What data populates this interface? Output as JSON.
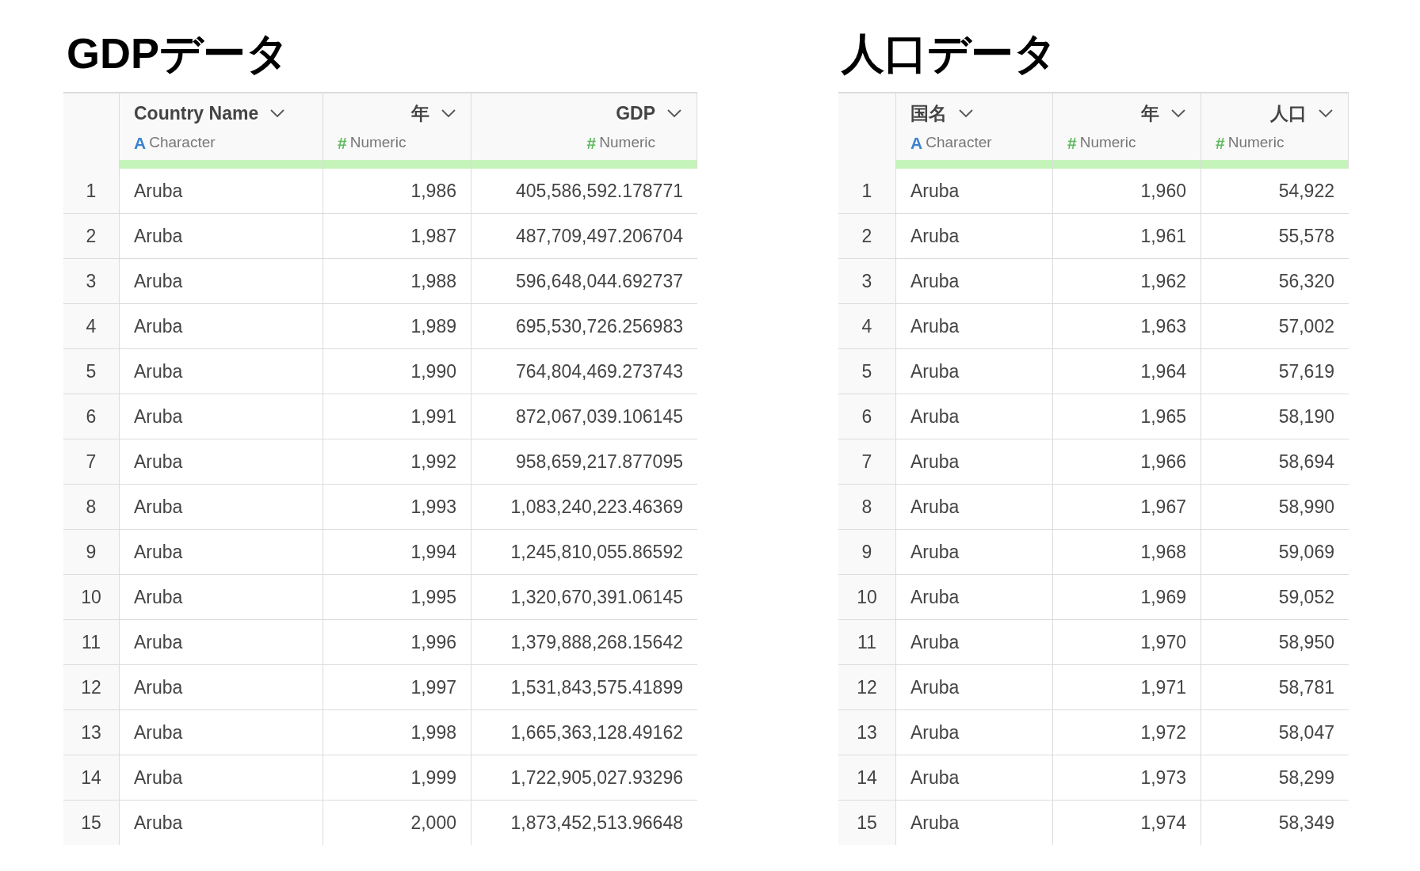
{
  "tables": [
    {
      "title": "GDPデータ",
      "columns": [
        {
          "name": "Country Name",
          "kind": "character",
          "type_symbol": "A",
          "type_label": "Character"
        },
        {
          "name": "年",
          "kind": "numeric",
          "type_symbol": "#",
          "type_label": "Numeric"
        },
        {
          "name": "GDP",
          "kind": "numeric",
          "type_symbol": "#",
          "type_label": "Numeric"
        }
      ],
      "rows": [
        {
          "index": "1",
          "cells": [
            "Aruba",
            "1,986",
            "405,586,592.178771"
          ]
        },
        {
          "index": "2",
          "cells": [
            "Aruba",
            "1,987",
            "487,709,497.206704"
          ]
        },
        {
          "index": "3",
          "cells": [
            "Aruba",
            "1,988",
            "596,648,044.692737"
          ]
        },
        {
          "index": "4",
          "cells": [
            "Aruba",
            "1,989",
            "695,530,726.256983"
          ]
        },
        {
          "index": "5",
          "cells": [
            "Aruba",
            "1,990",
            "764,804,469.273743"
          ]
        },
        {
          "index": "6",
          "cells": [
            "Aruba",
            "1,991",
            "872,067,039.106145"
          ]
        },
        {
          "index": "7",
          "cells": [
            "Aruba",
            "1,992",
            "958,659,217.877095"
          ]
        },
        {
          "index": "8",
          "cells": [
            "Aruba",
            "1,993",
            "1,083,240,223.46369"
          ]
        },
        {
          "index": "9",
          "cells": [
            "Aruba",
            "1,994",
            "1,245,810,055.86592"
          ]
        },
        {
          "index": "10",
          "cells": [
            "Aruba",
            "1,995",
            "1,320,670,391.06145"
          ]
        },
        {
          "index": "11",
          "cells": [
            "Aruba",
            "1,996",
            "1,379,888,268.15642"
          ]
        },
        {
          "index": "12",
          "cells": [
            "Aruba",
            "1,997",
            "1,531,843,575.41899"
          ]
        },
        {
          "index": "13",
          "cells": [
            "Aruba",
            "1,998",
            "1,665,363,128.49162"
          ]
        },
        {
          "index": "14",
          "cells": [
            "Aruba",
            "1,999",
            "1,722,905,027.93296"
          ]
        },
        {
          "index": "15",
          "cells": [
            "Aruba",
            "2,000",
            "1,873,452,513.96648"
          ]
        }
      ]
    },
    {
      "title": "人口データ",
      "columns": [
        {
          "name": "国名",
          "kind": "character",
          "type_symbol": "A",
          "type_label": "Character"
        },
        {
          "name": "年",
          "kind": "numeric",
          "type_symbol": "#",
          "type_label": "Numeric"
        },
        {
          "name": "人口",
          "kind": "numeric",
          "type_symbol": "#",
          "type_label": "Numeric"
        }
      ],
      "rows": [
        {
          "index": "1",
          "cells": [
            "Aruba",
            "1,960",
            "54,922"
          ]
        },
        {
          "index": "2",
          "cells": [
            "Aruba",
            "1,961",
            "55,578"
          ]
        },
        {
          "index": "3",
          "cells": [
            "Aruba",
            "1,962",
            "56,320"
          ]
        },
        {
          "index": "4",
          "cells": [
            "Aruba",
            "1,963",
            "57,002"
          ]
        },
        {
          "index": "5",
          "cells": [
            "Aruba",
            "1,964",
            "57,619"
          ]
        },
        {
          "index": "6",
          "cells": [
            "Aruba",
            "1,965",
            "58,190"
          ]
        },
        {
          "index": "7",
          "cells": [
            "Aruba",
            "1,966",
            "58,694"
          ]
        },
        {
          "index": "8",
          "cells": [
            "Aruba",
            "1,967",
            "58,990"
          ]
        },
        {
          "index": "9",
          "cells": [
            "Aruba",
            "1,968",
            "59,069"
          ]
        },
        {
          "index": "10",
          "cells": [
            "Aruba",
            "1,969",
            "59,052"
          ]
        },
        {
          "index": "11",
          "cells": [
            "Aruba",
            "1,970",
            "58,950"
          ]
        },
        {
          "index": "12",
          "cells": [
            "Aruba",
            "1,971",
            "58,781"
          ]
        },
        {
          "index": "13",
          "cells": [
            "Aruba",
            "1,972",
            "58,047"
          ]
        },
        {
          "index": "14",
          "cells": [
            "Aruba",
            "1,973",
            "58,299"
          ]
        },
        {
          "index": "15",
          "cells": [
            "Aruba",
            "1,974",
            "58,349"
          ]
        }
      ]
    }
  ]
}
